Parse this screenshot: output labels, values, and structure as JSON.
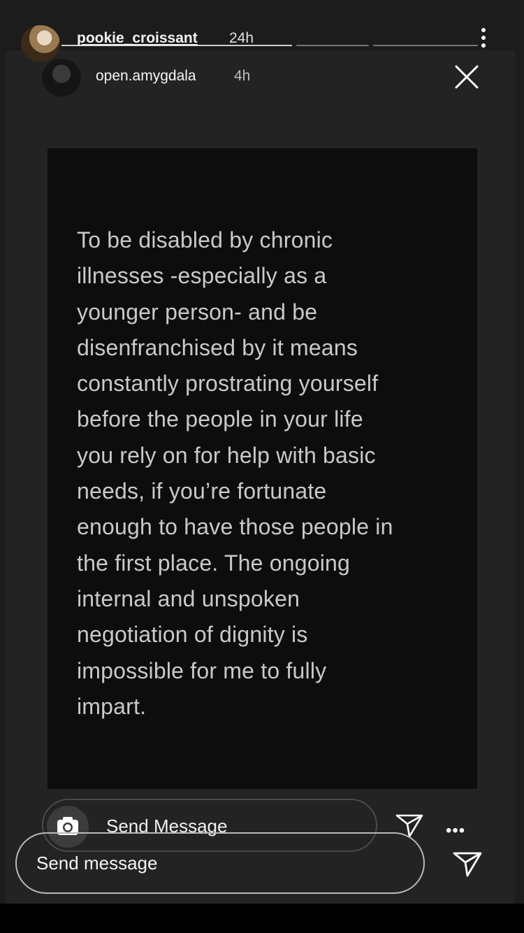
{
  "outer_story": {
    "username": "pookie_croissant",
    "time": "24h",
    "progress_segments": [
      1,
      0,
      0
    ],
    "composer_placeholder": "Send message"
  },
  "inner_story": {
    "username": "open.amygdala",
    "time": "4h",
    "quote": "To be disabled by chronic\nillnesses -especially as a\nyounger person- and  be\ndisenfranchised by it means\nconstantly prostrating yourself\nbefore the people in your life\nyou rely on for help with basic\nneeds, if you’re fortunate\nenough to have those people in\nthe first place. The ongoing\ninternal and unspoken\nnegotiation of dignity is\nimpossible for me to fully\nimpart.",
    "composer_placeholder": "Send Message",
    "more_label": "•••"
  },
  "icons": {
    "more": "more-vertical-icon",
    "close": "close-icon",
    "camera": "camera-icon",
    "send": "send-icon"
  },
  "colors": {
    "background": "#1c1c1d",
    "card": "#0d0d0d",
    "quote_text": "#c9c9c9"
  }
}
